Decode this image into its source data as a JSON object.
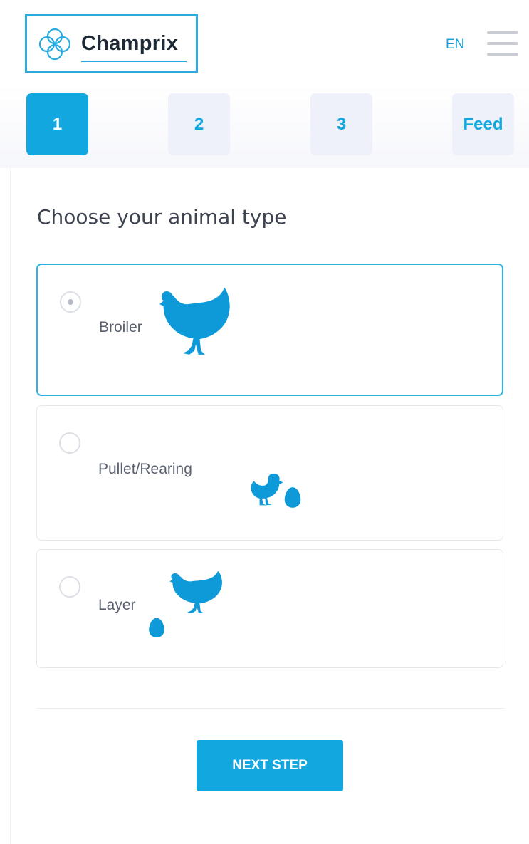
{
  "header": {
    "logo_text": "Champrix",
    "language": "EN",
    "menu_icon": "hamburger-icon"
  },
  "steps": [
    {
      "label": "1",
      "active": true
    },
    {
      "label": "2",
      "active": false
    },
    {
      "label": "3",
      "active": false
    },
    {
      "label": "Feed",
      "active": false
    }
  ],
  "form": {
    "title": "Choose your animal type",
    "options": [
      {
        "label": "Broiler",
        "selected": true,
        "icon": "hen-icon"
      },
      {
        "label": "Pullet/Rearing",
        "selected": false,
        "icon": "chick-egg-icon"
      },
      {
        "label": "Layer",
        "selected": false,
        "icon": "hen-egg-icon"
      }
    ],
    "next_button": "NEXT STEP"
  },
  "colors": {
    "accent": "#12a7df",
    "logo_border": "#29abe2",
    "step_inactive_bg": "#eef0fa",
    "animal_fill": "#0e9ad8"
  }
}
